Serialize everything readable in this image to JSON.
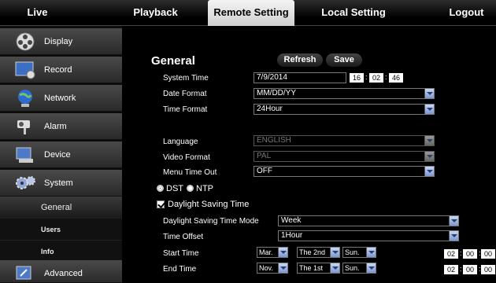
{
  "nav": {
    "tabs": [
      "Live",
      "Playback",
      "Remote Setting",
      "Local Setting",
      "Logout"
    ],
    "active": "Remote Setting"
  },
  "sidebar": {
    "items": [
      {
        "label": "Display",
        "icon": "film-reel-icon"
      },
      {
        "label": "Record",
        "icon": "monitor-record-icon"
      },
      {
        "label": "Network",
        "icon": "globe-network-icon"
      },
      {
        "label": "Alarm",
        "icon": "camera-alarm-icon"
      },
      {
        "label": "Device",
        "icon": "device-disk-icon"
      },
      {
        "label": "System",
        "icon": "gears-icon"
      },
      {
        "label": "Advanced",
        "icon": "advanced-tools-icon"
      }
    ],
    "subitems": [
      "General",
      "Users",
      "Info"
    ],
    "active_subitem": "General"
  },
  "general": {
    "title": "General",
    "refresh_label": "Refresh",
    "save_label": "Save",
    "system_time_label": "System Time",
    "system_date": "7/9/2014",
    "time_h": "16",
    "time_m": "02",
    "time_s": "46",
    "date_format_label": "Date Format",
    "date_format": "MM/DD/YY",
    "time_format_label": "Time Format",
    "time_format": "24Hour",
    "language_label": "Language",
    "language": "ENGLISH",
    "video_format_label": "Video Format",
    "video_format": "PAL",
    "menu_timeout_label": "Menu Time Out",
    "menu_timeout": "OFF",
    "dst_label": "DST",
    "ntp_label": "NTP",
    "dst_checkbox_label": "Daylight Saving Time",
    "dst_mode_label": "Daylight Saving Time Mode",
    "dst_mode": "Week",
    "time_offset_label": "Time Offset",
    "time_offset": "1Hour",
    "start_time_label": "Start Time",
    "start_month": "Mar.",
    "start_week": "The 2nd",
    "start_day": "Sun.",
    "start_h": "02",
    "start_m": "00",
    "start_s": "00",
    "end_time_label": "End Time",
    "end_month": "Nov.",
    "end_week": "The 1st",
    "end_day": "Sun.",
    "end_h": "02",
    "end_m": "00",
    "end_s": "00"
  },
  "colors": {
    "select_arrow": "#7b97d2",
    "active_tab": "#e8e8e8"
  }
}
